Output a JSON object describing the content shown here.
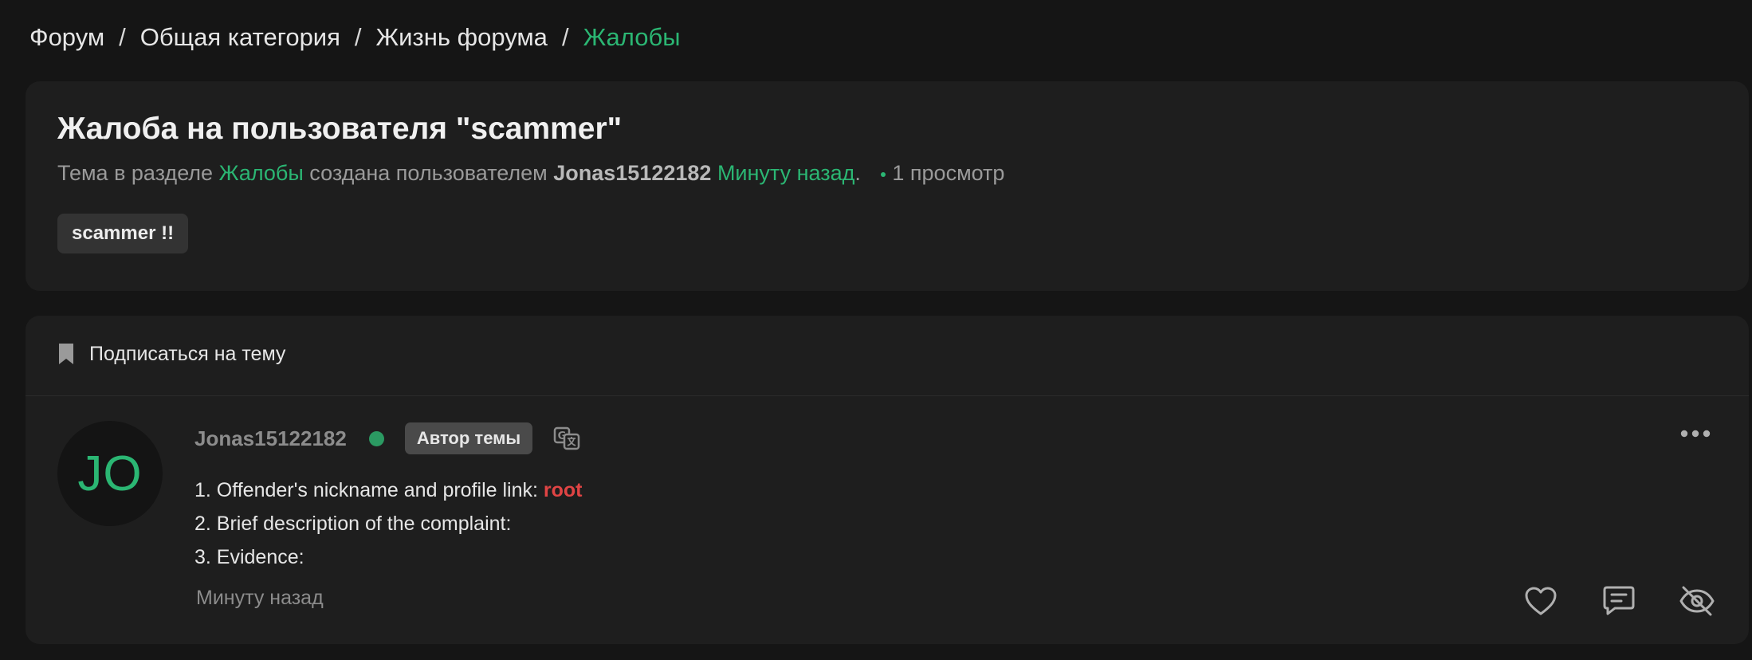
{
  "breadcrumb": {
    "items": [
      "Форум",
      "Общая категория",
      "Жизнь форума",
      "Жалобы"
    ],
    "separator": "/"
  },
  "thread": {
    "title": "Жалоба на пользователя \"scammer\"",
    "meta_prefix": "Тема в разделе ",
    "section": "Жалобы",
    "meta_mid": " создана пользователем ",
    "author": "Jonas15122182",
    "created": "Минуту назад",
    "created_suffix": ".",
    "views": "1 просмотр",
    "tag": "scammer !!"
  },
  "post": {
    "subscribe_label": "Подписаться на тему",
    "avatar_initials": "JO",
    "username": "Jonas15122182",
    "author_badge": "Автор темы",
    "lines": [
      {
        "text": "1. Offender's nickname and profile link: ",
        "highlight": "root"
      },
      {
        "text": "2. Brief description of the complaint:"
      },
      {
        "text": "3. Evidence:"
      }
    ],
    "time": "Минуту назад"
  },
  "icons": {
    "subscribe": "bookmark-icon",
    "translate": "translate-icon",
    "more": "more-dots-icon",
    "like": "heart-icon",
    "reply": "comment-icon",
    "hide": "eye-off-icon"
  },
  "colors": {
    "accent": "#2bb673",
    "highlight_red": "#e04444",
    "background": "#151515",
    "card": "#1e1e1e"
  }
}
